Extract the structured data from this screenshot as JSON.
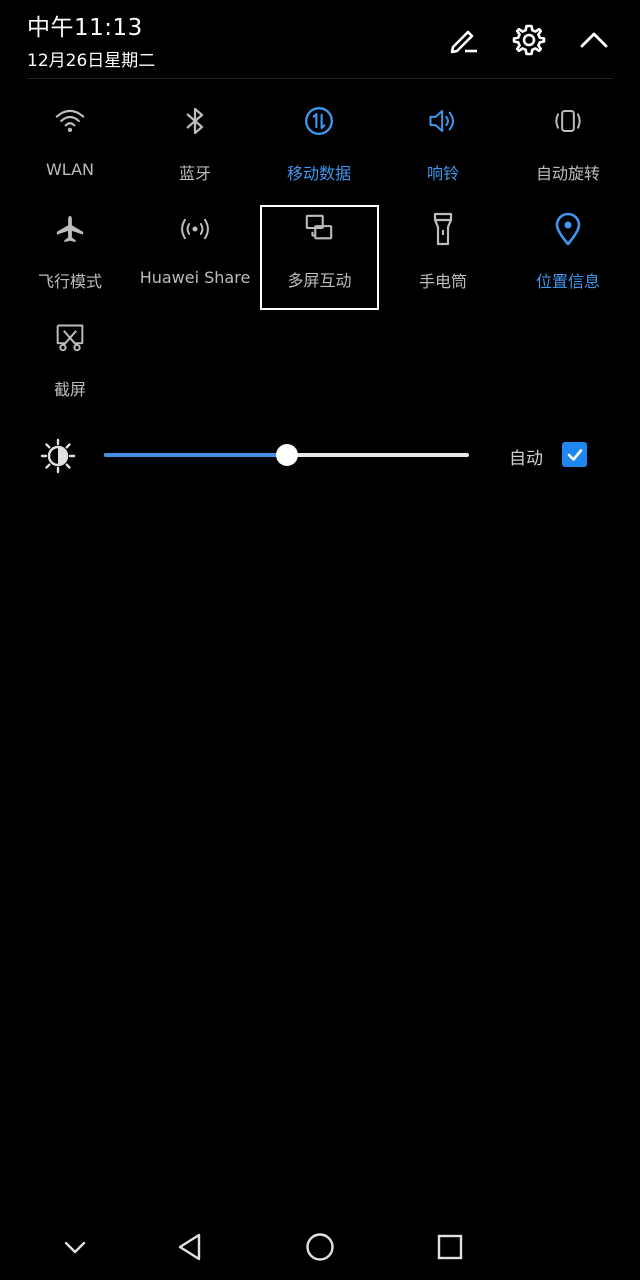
{
  "header": {
    "time": "中午11:13",
    "date": "12月26日星期二"
  },
  "tiles": [
    {
      "label": "WLAN",
      "icon": "wifi-icon",
      "active": false
    },
    {
      "label": "蓝牙",
      "icon": "bluetooth-icon",
      "active": false
    },
    {
      "label": "移动数据",
      "icon": "mobile-data-icon",
      "active": true
    },
    {
      "label": "响铃",
      "icon": "volume-icon",
      "active": true
    },
    {
      "label": "自动旋转",
      "icon": "rotate-icon",
      "active": false
    },
    {
      "label": "飞行模式",
      "icon": "airplane-icon",
      "active": false
    },
    {
      "label": "Huawei Share",
      "icon": "huawei-share-icon",
      "active": false
    },
    {
      "label": "多屏互动",
      "icon": "multi-screen-icon",
      "active": false,
      "highlighted": true
    },
    {
      "label": "手电筒",
      "icon": "flashlight-icon",
      "active": false
    },
    {
      "label": "位置信息",
      "icon": "location-icon",
      "active": true
    },
    {
      "label": "截屏",
      "icon": "screenshot-icon",
      "active": false
    }
  ],
  "brightness": {
    "level_fraction": 0.5,
    "auto_label": "自动",
    "auto_checked": true
  },
  "colors": {
    "accent": "#3f97ef",
    "inactive": "#bdbdbd",
    "background": "#000000"
  },
  "navbar": {
    "buttons": [
      "pull-down-icon",
      "back-icon",
      "home-icon",
      "recents-icon"
    ]
  }
}
